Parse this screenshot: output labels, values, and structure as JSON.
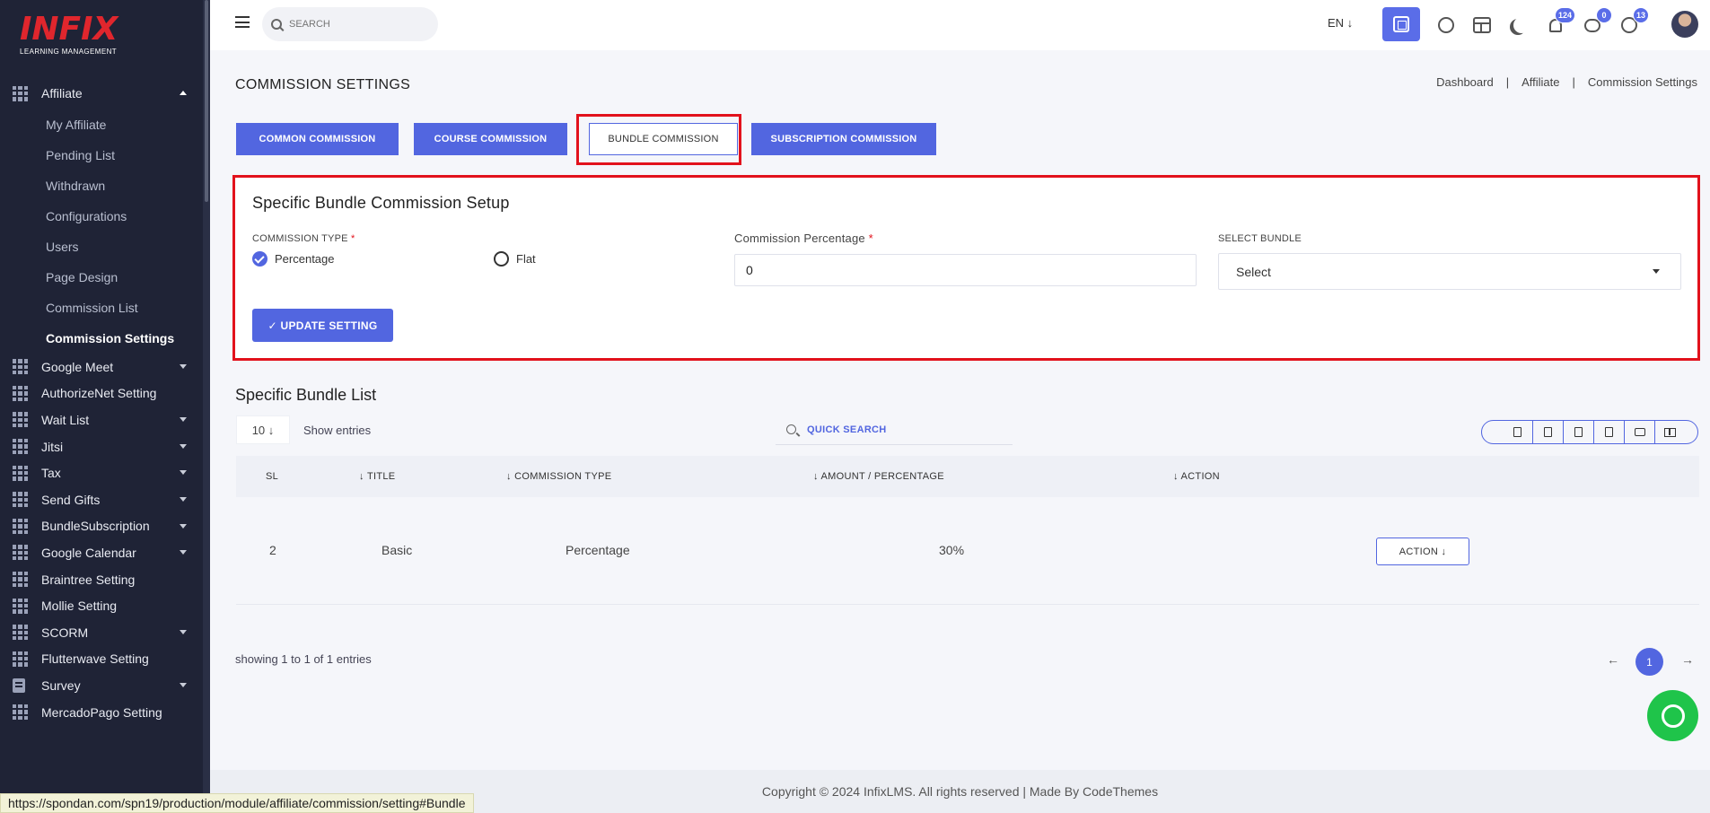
{
  "logo": {
    "main": "INFIX",
    "sub": "LEARNING MANAGEMENT"
  },
  "sidebar": {
    "items": [
      {
        "label": "Affiliate",
        "icon": "grid-icon",
        "expanded": true,
        "children": [
          "My Affiliate",
          "Pending List",
          "Withdrawn",
          "Configurations",
          "Users",
          "Page Design",
          "Commission List",
          "Commission Settings"
        ],
        "active_child": "Commission Settings"
      },
      {
        "label": "Google Meet",
        "icon": "grid-icon",
        "caret": true
      },
      {
        "label": "AuthorizeNet Setting",
        "icon": "grid-icon",
        "caret": false
      },
      {
        "label": "Wait List",
        "icon": "grid-icon",
        "caret": true
      },
      {
        "label": "Jitsi",
        "icon": "grid-icon",
        "caret": true
      },
      {
        "label": "Tax",
        "icon": "grid-icon",
        "caret": true
      },
      {
        "label": "Send Gifts",
        "icon": "grid-icon",
        "caret": true
      },
      {
        "label": "BundleSubscription",
        "icon": "grid-icon",
        "caret": true
      },
      {
        "label": "Google Calendar",
        "icon": "grid-icon",
        "caret": true
      },
      {
        "label": "Braintree Setting",
        "icon": "grid-icon",
        "caret": false
      },
      {
        "label": "Mollie Setting",
        "icon": "grid-icon",
        "caret": false
      },
      {
        "label": "SCORM",
        "icon": "grid-icon",
        "caret": true
      },
      {
        "label": "Flutterwave Setting",
        "icon": "grid-icon",
        "caret": false
      },
      {
        "label": "Survey",
        "icon": "doc-icon",
        "caret": true
      },
      {
        "label": "MercadoPago Setting",
        "icon": "grid-icon",
        "caret": false
      }
    ]
  },
  "topbar": {
    "search_placeholder": "SEARCH",
    "language": "EN ↓",
    "notifications_count": "124",
    "messages_count": "0",
    "whatsapp_count": "13"
  },
  "page": {
    "title": "COMMISSION SETTINGS",
    "breadcrumb": [
      "Dashboard",
      "Affiliate",
      "Commission Settings"
    ]
  },
  "tabs": [
    {
      "label": "COMMON COMMISSION",
      "active": false
    },
    {
      "label": "COURSE COMMISSION",
      "active": false
    },
    {
      "label": "BUNDLE COMMISSION",
      "active": true
    },
    {
      "label": "SUBSCRIPTION COMMISSION",
      "active": false
    }
  ],
  "form": {
    "title": "Specific Bundle Commission Setup",
    "commission_type_label": "COMMISSION TYPE",
    "required_mark": "*",
    "radio_percentage": "Percentage",
    "radio_flat": "Flat",
    "selected_type": "Percentage",
    "percentage_label": "Commission Percentage",
    "percentage_value": "0",
    "bundle_label": "SELECT BUNDLE",
    "bundle_value": "Select",
    "update_button": "✓ UPDATE SETTING"
  },
  "list": {
    "title": "Specific Bundle List",
    "entries_value": "10 ↓",
    "show_entries": "Show entries",
    "quick_search": "QUICK SEARCH",
    "export_buttons": [
      "copy-icon",
      "excel-icon",
      "csv-icon",
      "pdf-icon",
      "print-icon",
      "columns-icon"
    ],
    "columns": [
      "SL",
      "↓ TITLE",
      "↓ COMMISSION TYPE",
      "↓ AMOUNT / PERCENTAGE",
      "↓ ACTION"
    ],
    "rows": [
      {
        "sl": "2",
        "title": "Basic",
        "type": "Percentage",
        "amount": "30%",
        "action": "ACTION ↓"
      }
    ],
    "showing": "showing 1 to 1 of 1 entries",
    "page_prev": "←",
    "current_page": "1",
    "page_next": "→"
  },
  "footer": {
    "text": "Copyright © 2024 InfixLMS. All rights reserved | Made By CodeThemes"
  },
  "status_url": "https://spondan.com/spn19/production/module/affiliate/commission/setting#Bundle",
  "colors": {
    "primary": "#5266e0",
    "sidebar": "#1f2336",
    "highlight": "#e2121c",
    "whatsapp": "#1fc44a"
  }
}
